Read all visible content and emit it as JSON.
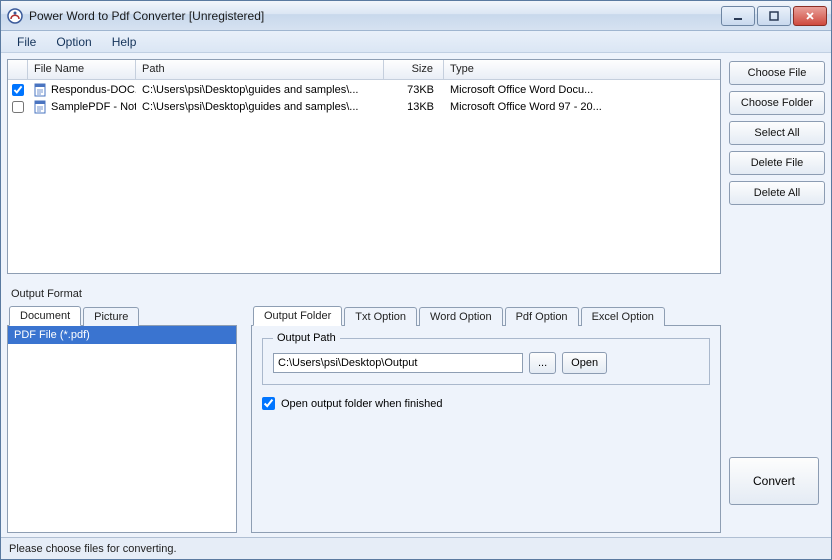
{
  "window": {
    "title": "Power Word to Pdf Converter [Unregistered]"
  },
  "menu": {
    "file": "File",
    "option": "Option",
    "help": "Help"
  },
  "columns": {
    "filename": "File Name",
    "path": "Path",
    "size": "Size",
    "type": "Type"
  },
  "files": [
    {
      "checked": true,
      "name": "Respondus-DOC...",
      "path": "C:\\Users\\psi\\Desktop\\guides and samples\\...",
      "size": "73KB",
      "type": "Microsoft Office Word Docu..."
    },
    {
      "checked": false,
      "name": "SamplePDF - Not...",
      "path": "C:\\Users\\psi\\Desktop\\guides and samples\\...",
      "size": "13KB",
      "type": "Microsoft Office Word 97 - 20..."
    }
  ],
  "buttons": {
    "choose_file": "Choose File",
    "choose_folder": "Choose Folder",
    "select_all": "Select All",
    "delete_file": "Delete File",
    "delete_all": "Delete All",
    "browse": "...",
    "open": "Open",
    "convert": "Convert"
  },
  "labels": {
    "output_format": "Output Format",
    "tab_document": "Document",
    "tab_picture": "Picture",
    "format_entry": "PDF File  (*.pdf)",
    "tab_output_folder": "Output Folder",
    "tab_txt": "Txt Option",
    "tab_word": "Word Option",
    "tab_pdf": "Pdf Option",
    "tab_excel": "Excel Option",
    "output_path_legend": "Output Path",
    "open_when_finished": "Open output folder when finished"
  },
  "output_path": "C:\\Users\\psi\\Desktop\\Output",
  "status": "Please choose files for converting."
}
